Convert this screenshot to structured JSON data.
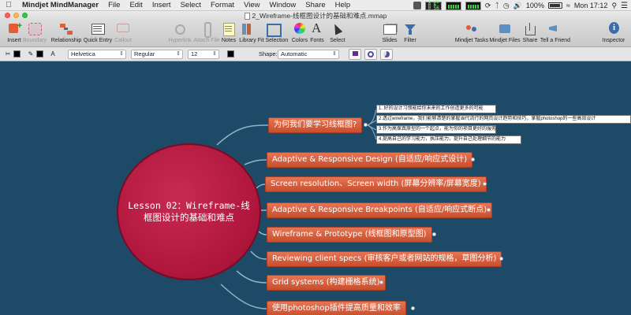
{
  "menubar": {
    "app_name": "Mindjet MindManager",
    "items": [
      "File",
      "Edit",
      "Insert",
      "Select",
      "Format",
      "View",
      "Window",
      "Share",
      "Help"
    ],
    "cpu_readout": [
      "1 20",
      "0 6",
      "0 56"
    ],
    "battery_percent": "100%",
    "clock": "Mon 17:12"
  },
  "window": {
    "title": "2_Wireframe-线框图设计的基础和难点.mmap"
  },
  "toolbar": {
    "buttons": [
      {
        "label": "Insert",
        "icon": "insert-topic-icon",
        "enabled": true
      },
      {
        "label": "Boundary",
        "icon": "boundary-icon",
        "enabled": false
      },
      {
        "label": "Relationship",
        "icon": "relationship-icon",
        "enabled": true
      },
      {
        "label": "Quick Entry",
        "icon": "quick-entry-icon",
        "enabled": true
      },
      {
        "label": "Callout",
        "icon": "callout-icon",
        "enabled": false
      },
      {
        "label": "Hyperlink",
        "icon": "hyperlink-icon",
        "enabled": false
      },
      {
        "label": "Attach File",
        "icon": "attach-file-icon",
        "enabled": false
      },
      {
        "label": "Notes",
        "icon": "notes-icon",
        "enabled": true
      },
      {
        "label": "Library",
        "icon": "library-icon",
        "enabled": true
      },
      {
        "label": "Fit Selection",
        "icon": "fit-selection-icon",
        "enabled": true
      },
      {
        "label": "Colors",
        "icon": "colors-icon",
        "enabled": true
      },
      {
        "label": "Fonts",
        "icon": "fonts-icon",
        "enabled": true
      },
      {
        "label": "Select",
        "icon": "select-icon",
        "enabled": true
      },
      {
        "label": "Slides",
        "icon": "slides-icon",
        "enabled": true
      },
      {
        "label": "Filter",
        "icon": "filter-icon",
        "enabled": true
      },
      {
        "label": "Mindjet Tasks",
        "icon": "tasks-icon",
        "enabled": true
      },
      {
        "label": "Mindjet Files",
        "icon": "files-icon",
        "enabled": true
      },
      {
        "label": "Share",
        "icon": "share-icon",
        "enabled": true
      },
      {
        "label": "Tell a Friend",
        "icon": "megaphone-icon",
        "enabled": true
      },
      {
        "label": "Inspector",
        "icon": "inspector-icon",
        "enabled": true
      }
    ]
  },
  "formatbar": {
    "font": "Helvetica",
    "style": "Regular",
    "size": "12",
    "shape_label": "Shape:",
    "shape_value": "Automatic"
  },
  "map": {
    "central_topic": "Lesson 02：Wireframe-线框图设计的基础和难点",
    "topics": [
      "为何我们要学习线框图?",
      "Adaptive & Responsive Design (自适应/响应式设计)",
      "Screen resolution、Screen width (屏幕分辨率/屏幕宽度)",
      "Adaptive & Responsive Breakpoints (自适应/响应式断点)",
      "Wireframe & Prototype (线框图和原型图)",
      "Reviewing client specs (审核客户或者网站的规格，草图分析)",
      "Grid systems (构建栅格系统)",
      "使用photoshop插件提高质量和效率"
    ],
    "notes": [
      "1. 好的设计习惯能给你未来的工作创造更多的可能",
      "2.透过wireframe，我们能够清楚的掌握当代流行的网页设计趋势和技巧，掌握photoshop的一些高效设计",
      "3.作为高保真原型的一个起点，能为你的项目更好的服务",
      "4.提高自己的学习能力，执压能力，提升自己处理细节的能力"
    ]
  },
  "colors": {
    "canvas": "#1d4a66",
    "central": "#b0173d",
    "topic": "#d9603c",
    "branch": "#8fb4c8"
  }
}
